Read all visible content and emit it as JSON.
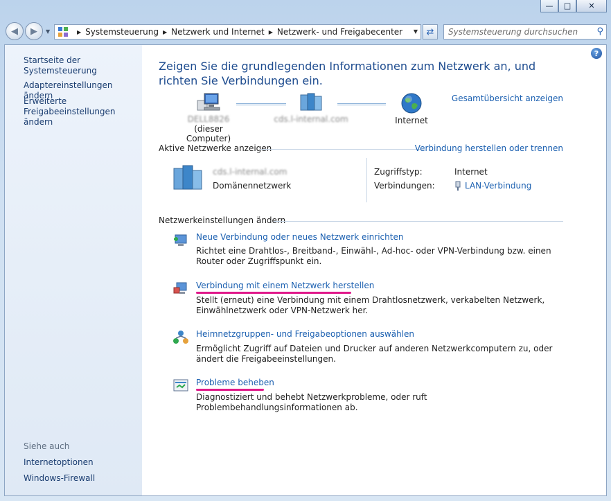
{
  "breadcrumb": [
    "Systemsteuerung",
    "Netzwerk und Internet",
    "Netzwerk- und Freigabecenter"
  ],
  "search": {
    "placeholder": "Systemsteuerung durchsuchen"
  },
  "sidebar": {
    "items": [
      "Startseite der Systemsteuerung",
      "Adaptereinstellungen ändern",
      "Erweiterte Freigabeeinstellungen ändern"
    ],
    "see_also_label": "Siehe auch",
    "see_also": [
      "Internetoptionen",
      "Windows-Firewall"
    ]
  },
  "main": {
    "title": "Zeigen Sie die grundlegenden Informationen zum Netzwerk an, und richten Sie Verbindungen ein.",
    "overview_link": "Gesamtübersicht anzeigen",
    "map": {
      "computer_name": "DELL8826",
      "computer_sub": "(dieser Computer)",
      "domain_name": "cds.l-internal.com",
      "internet": "Internet"
    },
    "active_header": "Aktive Netzwerke anzeigen",
    "connect_link": "Verbindung herstellen oder trennen",
    "active": {
      "name": "cds.l-internal.com",
      "type": "Domänennetzwerk",
      "access_label": "Zugriffstyp:",
      "access_value": "Internet",
      "connections_label": "Verbindungen:",
      "connections_value": "LAN-Verbindung"
    },
    "settings_header": "Netzwerkeinstellungen ändern",
    "tasks": [
      {
        "link": "Neue Verbindung oder neues Netzwerk einrichten",
        "desc": "Richtet eine Drahtlos-, Breitband-, Einwähl-, Ad-hoc- oder VPN-Verbindung bzw. einen Router oder Zugriffspunkt ein."
      },
      {
        "link": "Verbindung mit einem Netzwerk herstellen",
        "desc": "Stellt (erneut) eine Verbindung mit einem Drahtlosnetzwerk, verkabelten Netzwerk, Einwählnetzwerk oder VPN-Netzwerk her."
      },
      {
        "link": "Heimnetzgruppen- und Freigabeoptionen auswählen",
        "desc": "Ermöglicht Zugriff auf Dateien und Drucker auf anderen Netzwerkcomputern zu, oder ändert die Freigabeeinstellungen."
      },
      {
        "link": "Probleme beheben",
        "desc": "Diagnostiziert und behebt Netzwerkprobleme, oder ruft Problembehandlungsinformationen ab."
      }
    ]
  },
  "colors": {
    "link": "#1a5fb0",
    "title": "#1e4c8f",
    "highlight": "#e0188a"
  }
}
